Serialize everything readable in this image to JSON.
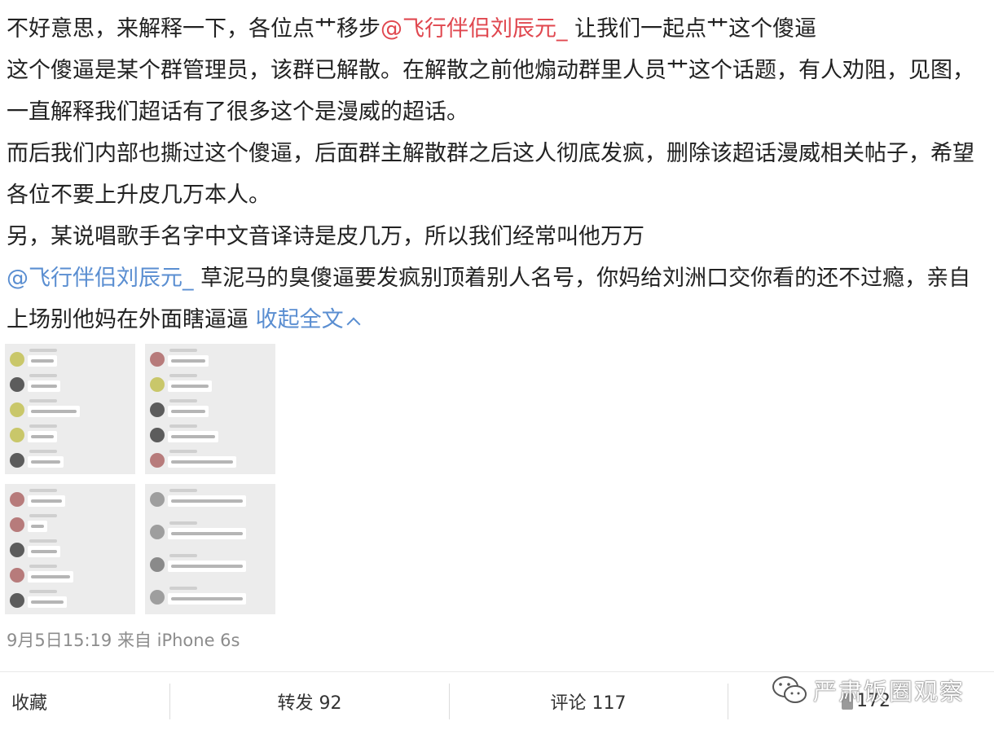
{
  "post": {
    "line1_before": "不好意思，来解释一下，各位点艹移步",
    "mention_1": "@飞行伴侣刘辰元_",
    "line1_after": " 让我们一起点艹这个傻逼",
    "para2": "这个傻逼是某个群管理员，该群已解散。在解散之前他煽动群里人员艹这个话题，有人劝阻，见图，一直解释我们超话有了很多这个是漫威的超话。",
    "para3": "而后我们内部也撕过这个傻逼，后面群主解散群之后这人彻底发疯，删除该超话漫威相关帖子，希望各位不要上升皮几万本人。",
    "para4": "另，某说唱歌手名字中文音译诗是皮几万，所以我们经常叫他万万",
    "mention_2": "@飞行伴侣刘辰元_",
    "para5": " 草泥马的臭傻逼要发疯别顶着别人名号，你妈给刘洲口交你看的还不过瘾，亲自上场别他妈在外面瞎逼逼 ",
    "expand_label": "收起全文"
  },
  "meta": {
    "timestamp": "9月5日15:19",
    "source": "来自 iPhone 6s"
  },
  "actions": {
    "favorite": "收藏",
    "repost": "转发 92",
    "comment": "评论 117",
    "like_count": "172"
  },
  "watermark": {
    "text": "严肃饭圈观察"
  },
  "colors": {
    "link": "#5a8ed1",
    "mention_red": "#e0474f",
    "text": "#222222",
    "meta": "#8c8c8c"
  }
}
